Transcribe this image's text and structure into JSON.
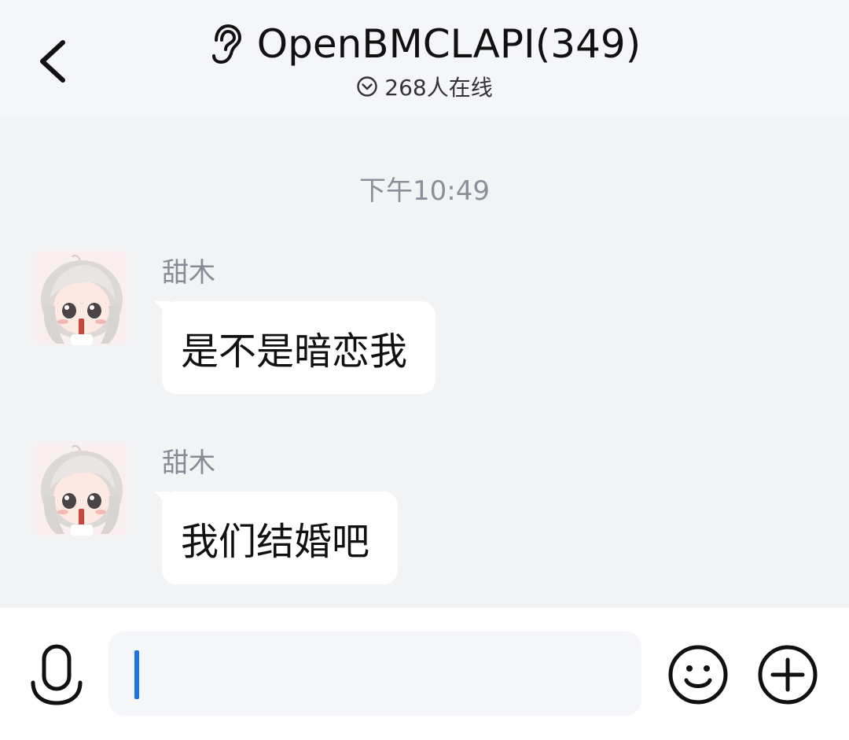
{
  "header": {
    "title": "OpenBMCLAPI(349)",
    "online": "268人在线",
    "back_icon": "chevron-left-icon",
    "mode_icon": "ear-icon",
    "online_icon": "chevron-down-circle-icon"
  },
  "chat": {
    "timestamp": "下午10:49",
    "messages": [
      {
        "sender": "甜木",
        "text": "是不是暗恋我",
        "avatar": "anime-avatar"
      },
      {
        "sender": "甜木",
        "text": "我们结婚吧",
        "avatar": "anime-avatar"
      }
    ]
  },
  "input_bar": {
    "value": "",
    "caret_color": "#1a73e8",
    "icons": [
      "microphone-icon",
      "emoji-icon",
      "plus-icon"
    ]
  },
  "colors": {
    "header_bg": "#f5f6fa",
    "chat_bg": "#f2f3f5",
    "bubble_bg": "#ffffff",
    "meta_text": "#8a8f99"
  }
}
